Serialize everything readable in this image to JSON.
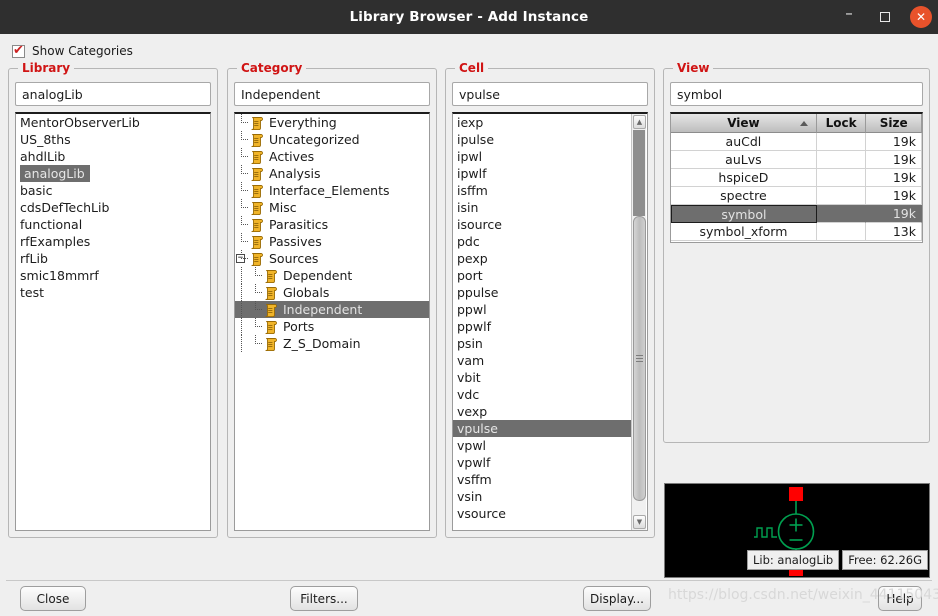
{
  "window": {
    "title": "Library Browser - Add Instance",
    "minimize_label": "–",
    "maximize_label": "",
    "close_label": "✕"
  },
  "options": {
    "show_categories_label": "Show Categories",
    "show_categories_checked": true,
    "check_glyph": "✔"
  },
  "library": {
    "group_label": "Library",
    "filter_value": "analogLib",
    "selected": "analogLib",
    "items": [
      "MentorObserverLib",
      "US_8ths",
      "ahdlLib",
      "analogLib",
      "basic",
      "cdsDefTechLib",
      "functional",
      "rfExamples",
      "rfLib",
      "smic18mmrf",
      "test"
    ]
  },
  "category": {
    "group_label": "Category",
    "filter_value": "Independent",
    "selected": "Independent",
    "expander_glyph": "−",
    "items": [
      {
        "label": "Everything",
        "depth": 1,
        "expander": false
      },
      {
        "label": "Uncategorized",
        "depth": 1,
        "expander": false
      },
      {
        "label": "Actives",
        "depth": 1,
        "expander": false
      },
      {
        "label": "Analysis",
        "depth": 1,
        "expander": false
      },
      {
        "label": "Interface_Elements",
        "depth": 1,
        "expander": false
      },
      {
        "label": "Misc",
        "depth": 1,
        "expander": false
      },
      {
        "label": "Parasitics",
        "depth": 1,
        "expander": false
      },
      {
        "label": "Passives",
        "depth": 1,
        "expander": false
      },
      {
        "label": "Sources",
        "depth": 1,
        "expander": true
      },
      {
        "label": "Dependent",
        "depth": 2,
        "expander": false
      },
      {
        "label": "Globals",
        "depth": 2,
        "expander": false
      },
      {
        "label": "Independent",
        "depth": 2,
        "expander": false
      },
      {
        "label": "Ports",
        "depth": 2,
        "expander": false
      },
      {
        "label": "Z_S_Domain",
        "depth": 2,
        "expander": false
      }
    ]
  },
  "cell": {
    "group_label": "Cell",
    "filter_value": "vpulse",
    "selected": "vpulse",
    "items": [
      "iexp",
      "ipulse",
      "ipwl",
      "ipwlf",
      "isffm",
      "isin",
      "isource",
      "pdc",
      "pexp",
      "port",
      "ppulse",
      "ppwl",
      "ppwlf",
      "psin",
      "vam",
      "vbit",
      "vdc",
      "vexp",
      "vpulse",
      "vpwl",
      "vpwlf",
      "vsffm",
      "vsin",
      "vsource"
    ]
  },
  "view": {
    "group_label": "View",
    "filter_value": "symbol",
    "selected": "symbol",
    "columns": [
      "View",
      "Lock",
      "Size"
    ],
    "sort_column": "View",
    "rows": [
      {
        "view": "auCdl",
        "lock": "",
        "size": "19k"
      },
      {
        "view": "auLvs",
        "lock": "",
        "size": "19k"
      },
      {
        "view": "hspiceD",
        "lock": "",
        "size": "19k"
      },
      {
        "view": "spectre",
        "lock": "",
        "size": "19k"
      },
      {
        "view": "symbol",
        "lock": "",
        "size": "19k"
      },
      {
        "view": "symbol_xform",
        "lock": "",
        "size": "13k"
      }
    ]
  },
  "preview": {
    "symbol_name": "vpulse",
    "plus_label": "+",
    "minus_label": "–",
    "wire_color": "#00a050",
    "terminal_color": "#ff0000",
    "background_color": "#000000"
  },
  "status": {
    "lib": "Lib: analogLib",
    "free": "Free: 62.26G"
  },
  "buttons": {
    "close": "Close",
    "filters": "Filters...",
    "display": "Display...",
    "help": "Help"
  },
  "watermark": {
    "text": "https://blog.csdn.net/weixin_44115043"
  }
}
